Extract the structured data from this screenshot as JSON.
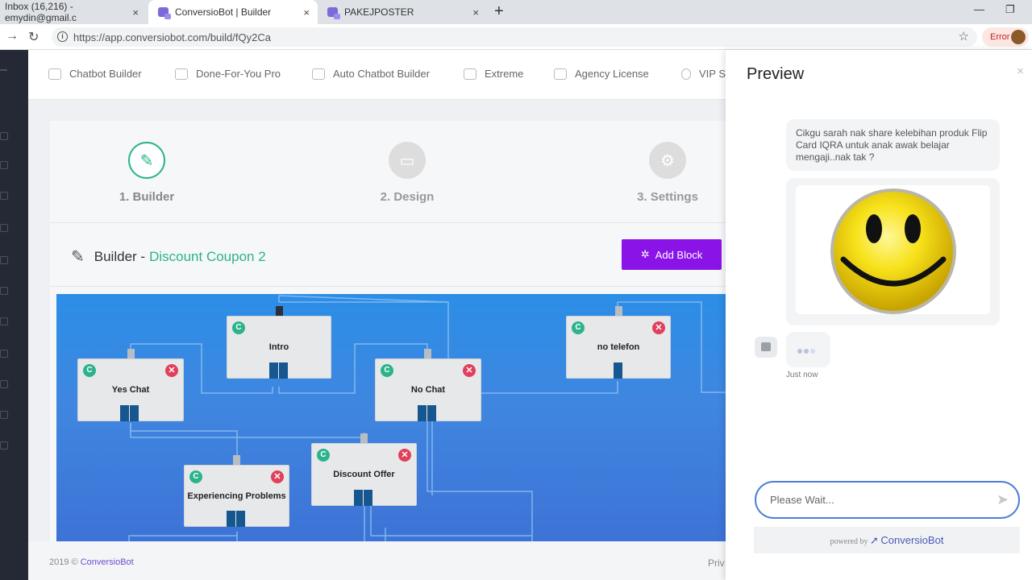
{
  "browser": {
    "tabs": [
      {
        "title": "Inbox (16,216) - emydin@gmail.c",
        "close": "×"
      },
      {
        "title": "ConversioBot | Builder",
        "close": "×"
      },
      {
        "title": "PAKEJPOSTER",
        "close": "×"
      }
    ],
    "new_tab": "+",
    "url": "https://app.conversiobot.com/build/fQy2Ca",
    "error_label": "Error",
    "window_controls": {
      "minimize": "—",
      "restore": "❐"
    }
  },
  "topnav": {
    "items": [
      {
        "label": "Chatbot Builder",
        "icon": "chatbot-icon"
      },
      {
        "label": "Done-For-You Pro",
        "icon": "cart-icon"
      },
      {
        "label": "Auto Chatbot Builder",
        "icon": "send-icon"
      },
      {
        "label": "Extreme",
        "icon": "timer-icon"
      },
      {
        "label": "Agency License",
        "icon": "chart-icon"
      },
      {
        "label": "VIP Su",
        "icon": "badge-icon"
      }
    ]
  },
  "steps": [
    {
      "label": "1. Builder",
      "icon": "pencil-icon",
      "active": true
    },
    {
      "label": "2. Design",
      "icon": "monitor-icon",
      "active": false
    },
    {
      "label": "3. Settings",
      "icon": "gear-icon",
      "active": false
    }
  ],
  "builder": {
    "title": "Builder -",
    "name": "Discount Coupon 2",
    "add_block": "Add Block"
  },
  "blocks": [
    {
      "title": "Intro",
      "badge": "C",
      "deletable": false
    },
    {
      "title": "Yes Chat",
      "badge": "C",
      "deletable": true
    },
    {
      "title": "No Chat",
      "badge": "C",
      "deletable": true
    },
    {
      "title": "no telefon",
      "badge": "C",
      "deletable": true
    },
    {
      "title": "Experiencing Problems",
      "badge": "C",
      "deletable": true
    },
    {
      "title": "Discount Offer",
      "badge": "C",
      "deletable": true
    }
  ],
  "footer": {
    "copyright": "2019 ©",
    "brand_link": "ConversioBot",
    "privacy": "Priv"
  },
  "preview": {
    "title": "Preview",
    "close": "×",
    "message": "Cikgu sarah nak share kelebihan produk Flip Card IQRA untuk anak awak belajar mengaji..nak tak ?",
    "image": "smiley-face",
    "timestamp": "Just now",
    "input_placeholder": "Please Wait...",
    "powered_by": "powered by",
    "powered_brand": "ConversioBot"
  },
  "colors": {
    "accent_green": "#2bb38c",
    "add_block_purple": "#8a14e8",
    "canvas_blue": "#3a85e0",
    "delete_red": "#e0405a"
  }
}
